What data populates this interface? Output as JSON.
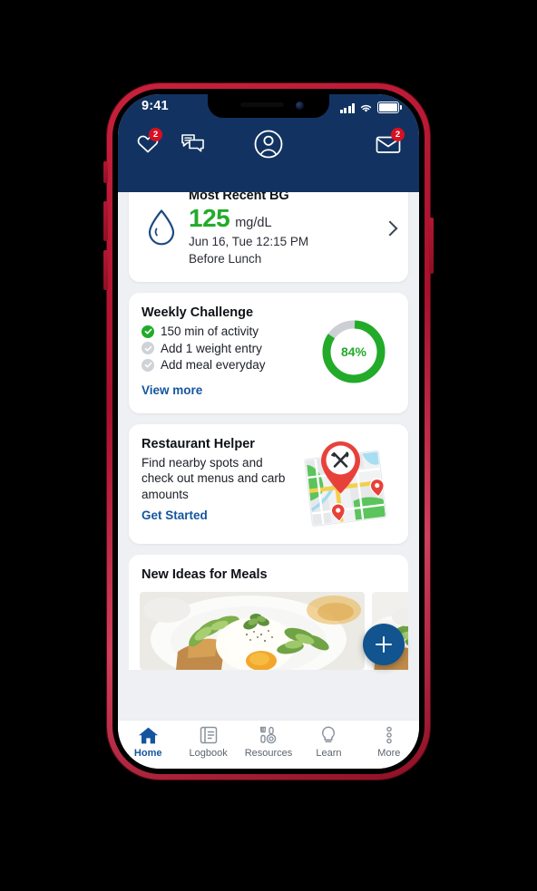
{
  "colors": {
    "bezel": "#b31634",
    "header_navy": "#123361",
    "page_bg": "#eef0f3",
    "card": "#ffffff",
    "accent_blue": "#14559e",
    "success_green": "#22ab29",
    "badge_red": "#d81021",
    "fab_blue": "#11548f",
    "ring_track": "#cccfd3"
  },
  "status_bar": {
    "time": "9:41",
    "signal_icon": "cellular-bars-icon",
    "wifi_icon": "wifi-icon",
    "battery_icon": "battery-icon"
  },
  "header": {
    "icons": [
      {
        "name": "heart-icon",
        "label": "Favorites",
        "badge": "2"
      },
      {
        "name": "chat-icon",
        "label": "Messages",
        "badge": ""
      },
      {
        "name": "profile-icon",
        "label": "Profile",
        "badge": ""
      },
      {
        "name": "mail-icon",
        "label": "Inbox",
        "badge": "2"
      }
    ]
  },
  "bg_card": {
    "icon": "blood-drop-icon",
    "title": "Most Recent BG",
    "value": "125",
    "unit": "mg/dL",
    "timestamp": "Jun 16, Tue 12:15 PM",
    "context": "Before Lunch",
    "chevron": "chevron-right-icon"
  },
  "weekly_challenge": {
    "title": "Weekly Challenge",
    "items": [
      {
        "label": "150 min of activity",
        "done": true
      },
      {
        "label": "Add 1 weight entry",
        "done": false
      },
      {
        "label": "Add meal everyday",
        "done": false
      }
    ],
    "link": "View more",
    "progress_percent": "84%",
    "progress_value": 84
  },
  "restaurant_helper": {
    "title": "Restaurant Helper",
    "description": "Find nearby spots and check out menus and carb amounts",
    "link": "Get Started",
    "art": "map-with-restaurant-pin-icon"
  },
  "meals": {
    "title": "New Ideas for Meals",
    "tiles": [
      {
        "alt": "avocado toast with poached egg"
      },
      {
        "alt": "second meal photo"
      }
    ]
  },
  "fab": {
    "icon": "plus-icon",
    "label": "Add entry"
  },
  "tabbar": {
    "tabs": [
      {
        "label": "Home",
        "icon": "home-icon",
        "active": true
      },
      {
        "label": "Logbook",
        "icon": "book-icon",
        "active": false
      },
      {
        "label": "Resources",
        "icon": "utensils-icon",
        "active": false
      },
      {
        "label": "Learn",
        "icon": "lightbulb-icon",
        "active": false
      },
      {
        "label": "More",
        "icon": "more-dots-icon",
        "active": false
      }
    ]
  }
}
